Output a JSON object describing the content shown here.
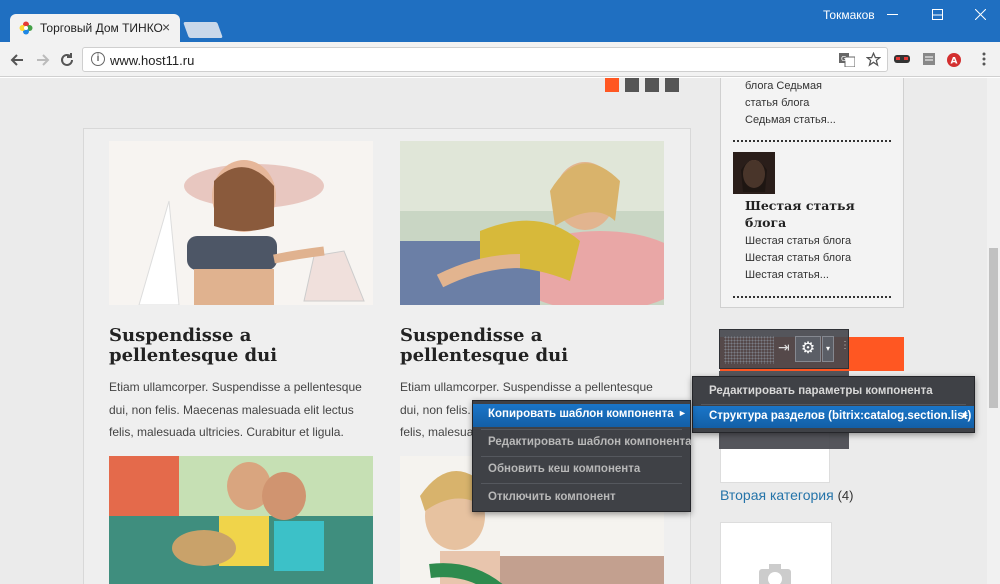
{
  "browser": {
    "tab_title": "Торговый Дом ТИНКО",
    "tab_close": "×",
    "user_name": "Токмаков",
    "url": "www.host11.ru",
    "info_glyph": "i"
  },
  "slider_dots": [
    {
      "color": "#ff5722",
      "active": true
    },
    {
      "color": "#555555",
      "active": false
    },
    {
      "color": "#555555",
      "active": false
    },
    {
      "color": "#555555",
      "active": false
    }
  ],
  "cards": [
    {
      "title": "Suspendisse a pellentesque dui",
      "text_lines": [
        "Etiam ullamcorper. Suspendisse a pellentesque",
        "dui, non felis. Maecenas malesuada elit lectus",
        "felis, malesuada ultricies. Curabitur et ligula."
      ]
    },
    {
      "title": "Suspendisse a pellentesque dui",
      "text_lines": [
        "Etiam ullamcorper. Suspendisse a pellentesque",
        "dui, non felis. Maecenas malesuada elit lectus",
        "felis, malesuada ultricies. Curabitur et ligula."
      ]
    }
  ],
  "sidebar": {
    "prev_article_lines": [
      "блога Седьмая",
      "статья блога",
      "Седьмая статья..."
    ],
    "article_title_lines": [
      "Шестая статья",
      "блога"
    ],
    "article_text_lines": [
      "Шестая статья блога",
      "Шестая статья блога",
      "Шестая статья..."
    ],
    "category_name": "Вторая категория",
    "category_count": "(4)"
  },
  "admin_panel": {
    "pin_glyph": "⇥",
    "gear_glyph": "⚙",
    "arrow_glyph": "▾",
    "dots_glyph": "⋮"
  },
  "context_menu": {
    "items": [
      {
        "label": "Копировать шаблон компонента",
        "active": true,
        "arrow": "►"
      },
      {
        "label": "Редактировать шаблон компонента",
        "active": false
      },
      {
        "label": "Обновить кеш компонента",
        "active": false
      },
      {
        "label": "Отключить компонент",
        "active": false
      }
    ]
  },
  "settings_menu": {
    "items": [
      {
        "label": "Редактировать параметры компонента",
        "active": false
      },
      {
        "label": "Структура разделов (bitrix:catalog.section.list)",
        "active": true,
        "arrow": "►"
      }
    ]
  }
}
